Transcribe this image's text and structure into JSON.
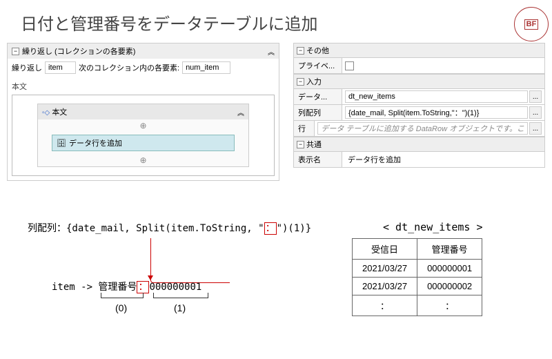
{
  "title": "日付と管理番号をデータテーブルに追加",
  "logo": {
    "text": "BF"
  },
  "designer": {
    "header": "繰り返し (コレクションの各要素)",
    "repeat_label": "繰り返し",
    "repeat_value": "item",
    "next_label": "次のコレクション内の各要素:",
    "next_value": "num_item",
    "body_label": "本文",
    "inner_header": "本文",
    "add_row_label": "データ行を追加"
  },
  "props": {
    "section_other": "その他",
    "private_label": "プライベ...",
    "section_input": "入力",
    "data_label": "データ...",
    "data_value": "dt_new_items",
    "array_label": "列配列",
    "array_value": "{date_mail, Split(item.ToString,\"：\")(1)}",
    "row_label": "行",
    "row_placeholder": "データ テーブルに追加する DataRow オブジェクトです。こ",
    "section_common": "共通",
    "display_label": "表示名",
    "display_value": "データ行を追加"
  },
  "explain": {
    "line1_prefix": "列配列：{date_mail, Split(item.ToString, \"",
    "line1_colon": "：",
    "line1_suffix": "\")(1)}",
    "item_prefix": "item -> 管理番号",
    "item_colon": "：",
    "item_suffix": "000000001",
    "idx0": "(0)",
    "idx1": "(1)"
  },
  "result": {
    "title": "< dt_new_items >",
    "headers": [
      "受信日",
      "管理番号"
    ],
    "rows": [
      [
        "2021/03/27",
        "000000001"
      ],
      [
        "2021/03/27",
        "000000002"
      ],
      [
        "：",
        "："
      ]
    ]
  }
}
